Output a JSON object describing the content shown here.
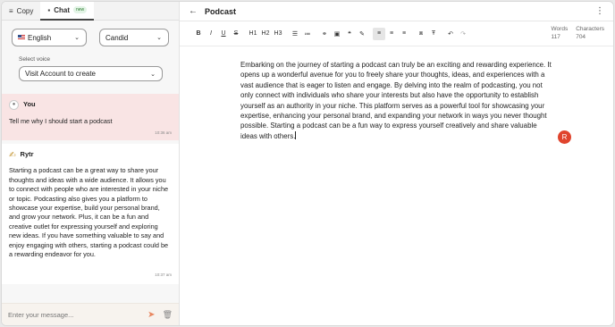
{
  "tabs": [
    {
      "label": "Copy",
      "icon": "menu-icon",
      "active": false
    },
    {
      "label": "Chat",
      "icon": "chat-icon",
      "active": true,
      "badge": "new"
    }
  ],
  "language_select": {
    "value": "English",
    "flag": "us-flag-icon"
  },
  "tone_select": {
    "value": "Candid"
  },
  "voice": {
    "label": "Select voice",
    "value": "Visit Account to create"
  },
  "messages": [
    {
      "author": "You",
      "text": "Tell me why I should start a podcast",
      "time": "10:36 am",
      "bg": "#f9e4e4"
    },
    {
      "author": "Rytr",
      "text": "Starting a podcast can be a great way to share your thoughts and ideas with a wide audience. It allows you to connect with people who are interested in your niche or topic. Podcasting also gives you a platform to showcase your expertise, build your personal brand, and grow your network. Plus, it can be a fun and creative outlet for expressing yourself and exploring new ideas. If you have something valuable to say and enjoy engaging with others, starting a podcast could be a rewarding endeavor for you.",
      "time": "10:37 am",
      "bg": "#ffffff"
    }
  ],
  "chat_input": {
    "placeholder": "Enter your message..."
  },
  "document": {
    "title": "Podcast",
    "words_label": "Words",
    "words": "117",
    "characters_label": "Characters",
    "characters": "704",
    "body": "Embarking on the journey of starting a podcast can truly be an exciting and rewarding experience. It opens up a wonderful avenue for you to freely share your thoughts, ideas, and experiences with a vast audience that is eager to listen and engage. By delving into the realm of podcasting, you not only connect with individuals who share your interests but also have the opportunity to establish yourself as an authority in your niche. This platform serves as a powerful tool for showcasing your expertise, enhancing your personal brand, and expanding your network in ways you never thought possible. Starting a podcast can be a fun way to express yourself creatively and share valuable ideas with others."
  },
  "toolbar": {
    "bold": "B",
    "italic": "I",
    "underline": "U",
    "strike": "S",
    "h1": "H1",
    "h2": "H2",
    "h3": "H3"
  },
  "user_avatar": {
    "initial": "R",
    "color": "#e0442d"
  },
  "colors": {
    "accent": "#e8865f",
    "user_bubble": "#f9e4e4"
  }
}
